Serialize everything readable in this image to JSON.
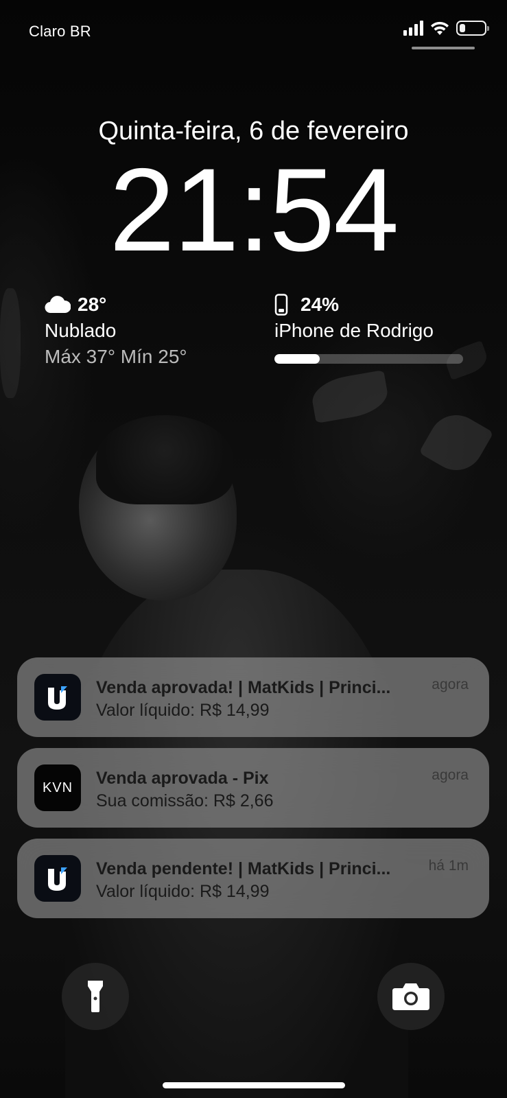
{
  "status_bar": {
    "carrier": "Claro BR",
    "battery_level": 0.24
  },
  "lock_screen": {
    "date": "Quinta-feira, 6 de fevereiro",
    "time": "21:54"
  },
  "weather_widget": {
    "icon": "cloud-icon",
    "temperature": "28°",
    "condition": "Nublado",
    "range": "Máx 37° Mín 25°"
  },
  "battery_widget": {
    "icon": "iphone-icon",
    "percent": "24%",
    "level": 0.24,
    "device_name": "iPhone de Rodrigo"
  },
  "notifications": [
    {
      "app_icon": "u-app-icon",
      "title": "Venda aprovada! | MatKids | Princi...",
      "body": "Valor líquido: R$ 14,99",
      "time": "agora"
    },
    {
      "app_icon": "kvn-app-icon",
      "app_icon_text": "KVN",
      "title": "Venda aprovada - Pix",
      "body": "Sua comissão: R$ 2,66",
      "time": "agora"
    },
    {
      "app_icon": "u-app-icon",
      "title": "Venda pendente! | MatKids | Princi...",
      "body": "Valor líquido: R$ 14,99",
      "time": "há 1m"
    }
  ],
  "bottom_controls": {
    "left": "flashlight-icon",
    "right": "camera-icon"
  }
}
